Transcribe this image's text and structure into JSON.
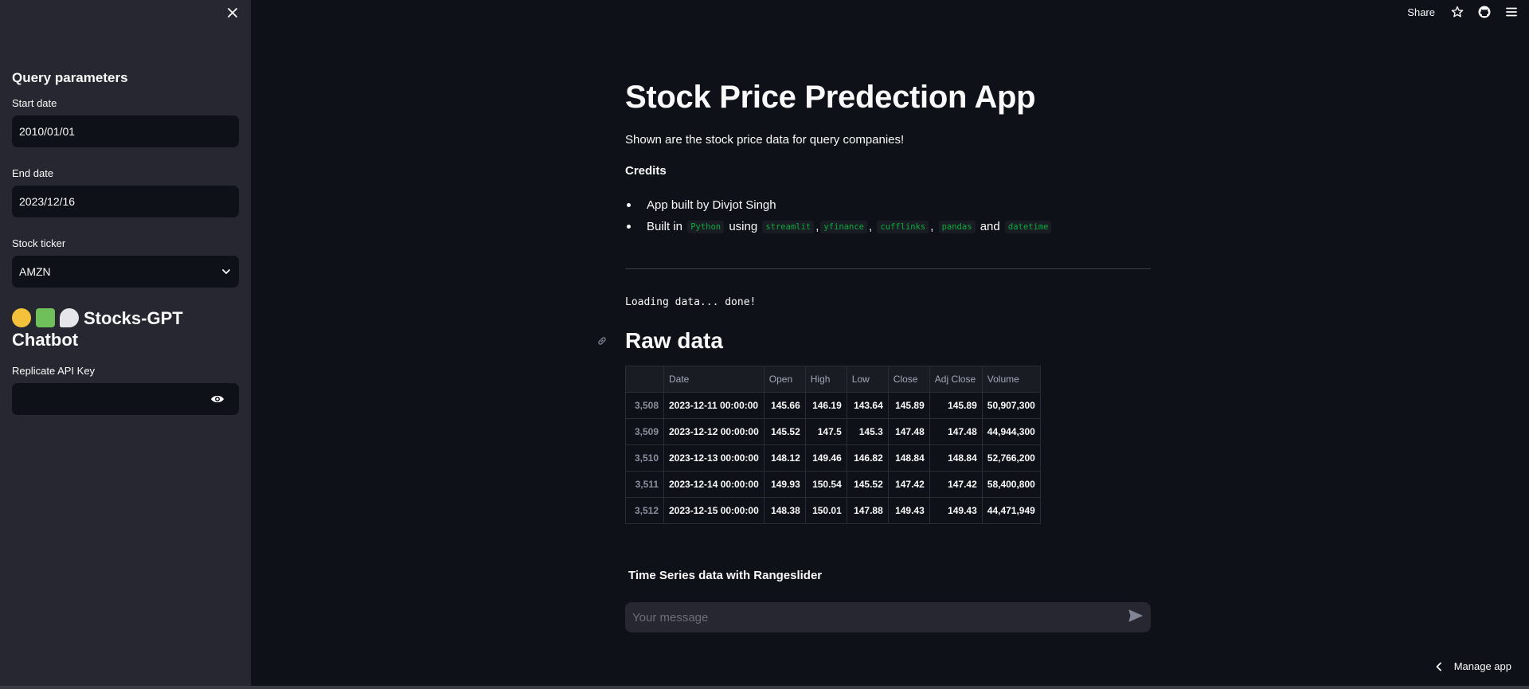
{
  "toolbar": {
    "share_label": "Share"
  },
  "sidebar": {
    "header": "Query parameters",
    "start_label": "Start date",
    "start_value": "2010/01/01",
    "end_label": "End date",
    "end_value": "2023/12/16",
    "ticker_label": "Stock ticker",
    "ticker_value": "AMZN",
    "chatbot_title": "Stocks-GPT Chatbot",
    "api_key_label": "Replicate API Key",
    "api_key_value": ""
  },
  "main": {
    "title": "Stock Price Predection App",
    "subtitle": "Shown are the stock price data for query companies!",
    "credits": "Credits",
    "credit_line1": "App built by Divjot Singh",
    "built_in": "Built in",
    "python": "Python",
    "using": "using",
    "libs": [
      "streamlit",
      "yfinance",
      "cufflinks",
      "pandas"
    ],
    "and": "and",
    "datetime": "datetime",
    "loading": "Loading data... done!",
    "raw_title": "Raw data",
    "ts_label": "Time Series data with Rangeslider",
    "chat_placeholder": "Your message"
  },
  "table": {
    "headers": [
      "",
      "Date",
      "Open",
      "High",
      "Low",
      "Close",
      "Adj Close",
      "Volume"
    ],
    "rows": [
      [
        "3,508",
        "2023-12-11 00:00:00",
        "145.66",
        "146.19",
        "143.64",
        "145.89",
        "145.89",
        "50,907,300"
      ],
      [
        "3,509",
        "2023-12-12 00:00:00",
        "145.52",
        "147.5",
        "145.3",
        "147.48",
        "147.48",
        "44,944,300"
      ],
      [
        "3,510",
        "2023-12-13 00:00:00",
        "148.12",
        "149.46",
        "146.82",
        "148.84",
        "148.84",
        "52,766,200"
      ],
      [
        "3,511",
        "2023-12-14 00:00:00",
        "149.93",
        "150.54",
        "145.52",
        "147.42",
        "147.42",
        "58,400,800"
      ],
      [
        "3,512",
        "2023-12-15 00:00:00",
        "148.38",
        "150.01",
        "147.88",
        "149.43",
        "149.43",
        "44,471,949"
      ]
    ]
  },
  "footer": {
    "manage_label": "Manage app"
  },
  "icons": {
    "close": "close-icon",
    "star": "star-icon",
    "github": "github-icon",
    "menu": "hamburger-menu-icon",
    "eye": "eye-icon",
    "send": "send-icon",
    "chevron": "chevron-down-icon",
    "link": "link-icon"
  }
}
